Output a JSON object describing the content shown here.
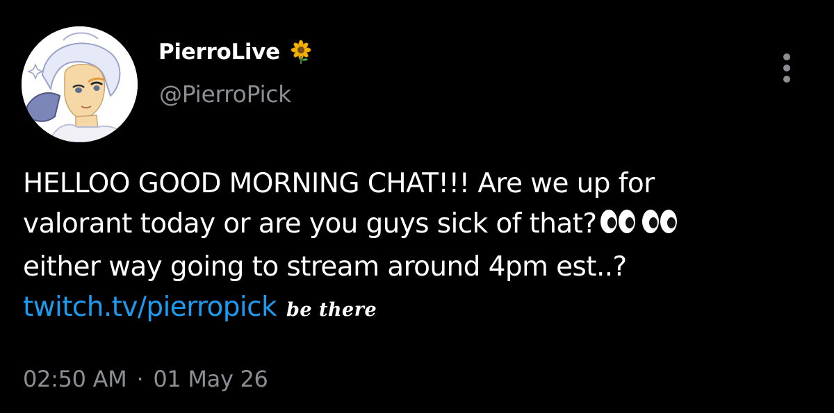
{
  "author": {
    "display_name": "PierroLive",
    "badge_icon": "sunflower-icon",
    "handle": "@PierroPick"
  },
  "tweet": {
    "lines": [
      "HELLOO GOOD MORNING CHAT!!! Are we up for",
      "valorant today or are you guys sick of that?",
      "either way going to stream around 4pm est..?"
    ],
    "emoji_after_line_2": "eyes-icon",
    "link_text": "twitch.tv/pierropick",
    "suffix_text": "be there"
  },
  "meta": {
    "time": "02:50 AM",
    "separator": "·",
    "date": "01 May 26"
  },
  "colors": {
    "background": "#000000",
    "text": "#ffffff",
    "secondary": "#8b8f94",
    "link": "#1d9bf0"
  }
}
